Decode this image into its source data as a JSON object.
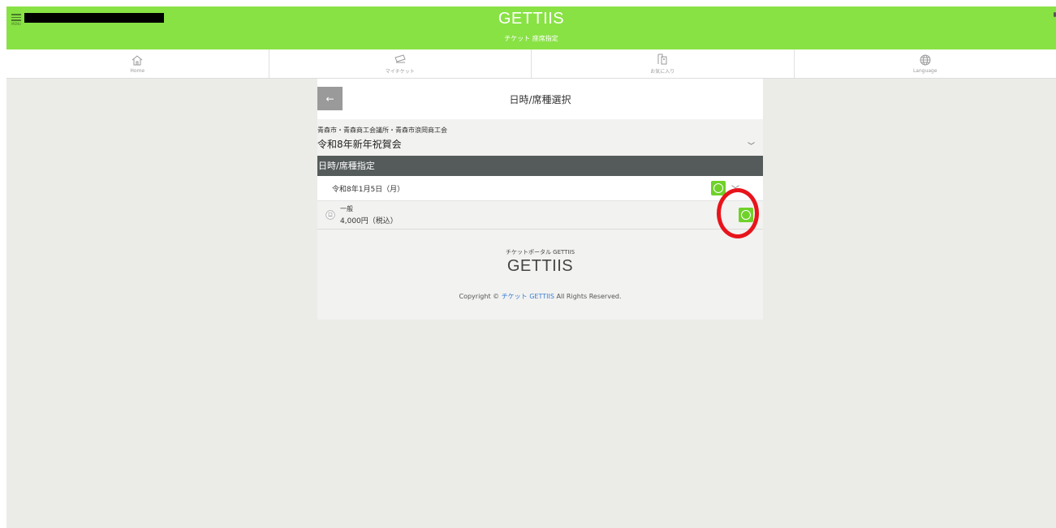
{
  "header": {
    "menu_label": "MENU",
    "brand": "GETTIIS",
    "subtitle": "チケット 座席指定",
    "bg_color": "#88e244"
  },
  "nav": {
    "items": [
      {
        "label": "Home",
        "icon": "home-icon"
      },
      {
        "label": "マイチケット",
        "icon": "ticket-icon"
      },
      {
        "label": "お気に入り",
        "icon": "favorite-icon"
      },
      {
        "label": "Language",
        "icon": "globe-icon"
      }
    ]
  },
  "panel": {
    "back_icon": "←",
    "title": "日時/席種選択",
    "organizer": "青森市・青森商工会議所・青森市浪岡商工会",
    "event_name": "令和8年新年祝賀会",
    "section_title": "日時/席種指定",
    "date": "令和8年1月5日（月）",
    "ticket_type": "一般",
    "ticket_price": "4,000円（税込）"
  },
  "footer": {
    "portal_label": "チケットポータル GETTIIS",
    "logo": "GETTIIS",
    "copyright_prefix": "Copyright ©",
    "copyright_link": "チケット GETTIIS",
    "copyright_suffix": "All Rights Reserved."
  },
  "colors": {
    "accent_green": "#6fd12a",
    "highlight_red": "#e8141b",
    "section_bar": "#555b5b"
  }
}
